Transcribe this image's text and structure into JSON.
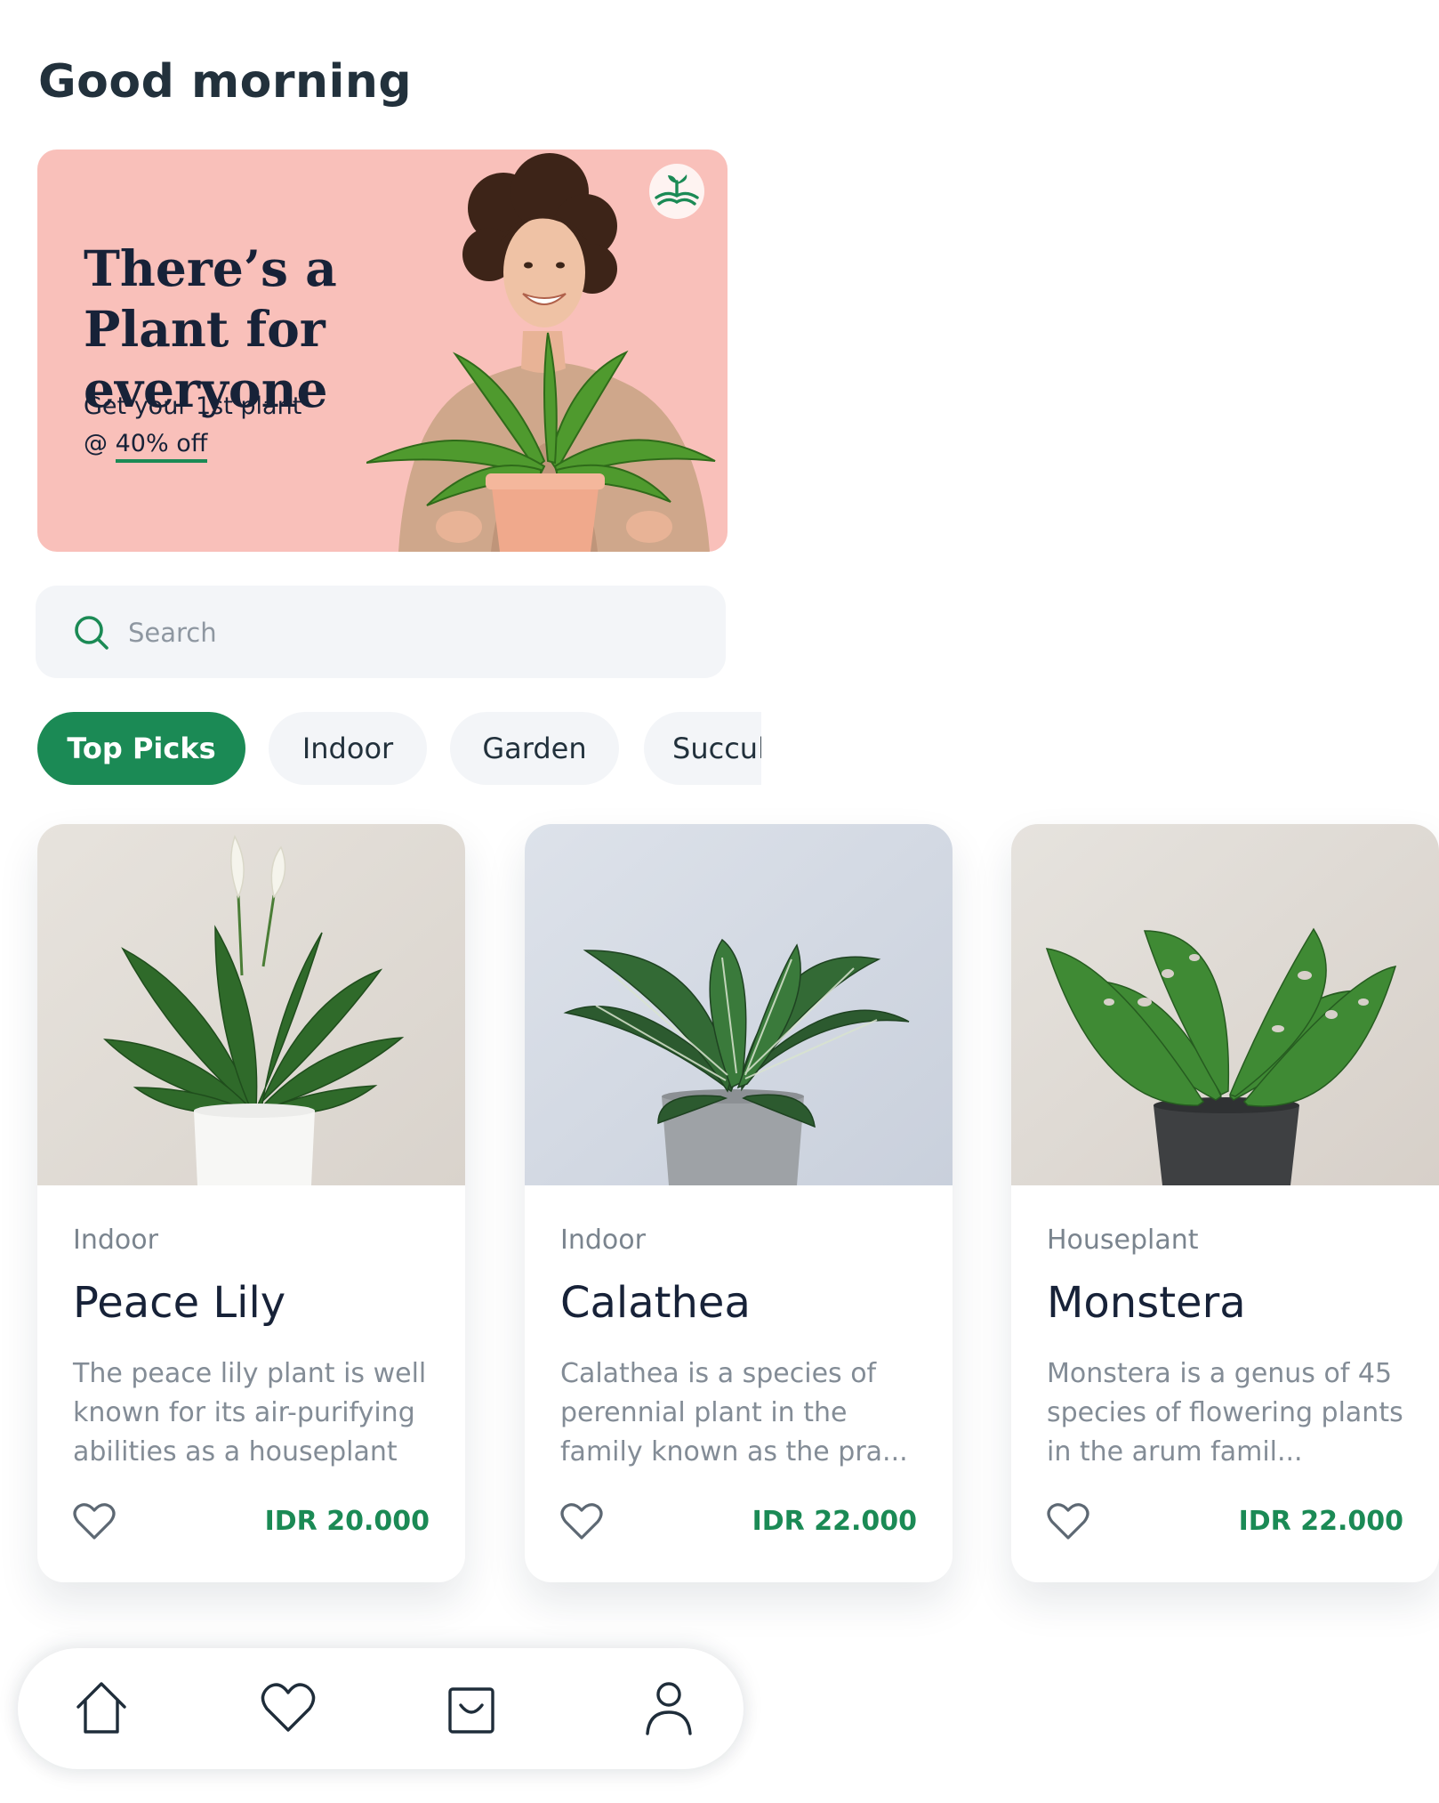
{
  "greeting": "Good morning",
  "banner": {
    "title": "There’s a Plant for everyone",
    "subtitle_prefix": "Get your 1st plant",
    "offer_prefix": "@ ",
    "offer": "40% off",
    "logo_icon": "sprout-logo-icon"
  },
  "search": {
    "placeholder": "Search",
    "value": "",
    "icon": "search-icon"
  },
  "categories": [
    {
      "label": "Top Picks",
      "active": true
    },
    {
      "label": "Indoor",
      "active": false
    },
    {
      "label": "Garden",
      "active": false
    },
    {
      "label": "Succulent",
      "active": false
    }
  ],
  "products": [
    {
      "category": "Indoor",
      "name": "Peace Lily",
      "description": "The peace lily plant is well known for its air-purifying abilities as a houseplant",
      "price": "IDR 20.000",
      "favorite_icon": "heart-outline-icon"
    },
    {
      "category": "Indoor",
      "name": "Calathea",
      "description": "Calathea is a species of perennial plant in the family known as the pra...",
      "price": "IDR 22.000",
      "favorite_icon": "heart-outline-icon"
    },
    {
      "category": "Houseplant",
      "name": "Monstera",
      "description": "Monstera is a genus of 45 species of flowering plants in the arum famil...",
      "price": "IDR 22.000",
      "favorite_icon": "heart-outline-icon"
    }
  ],
  "nav": [
    {
      "icon": "home-icon"
    },
    {
      "icon": "heart-icon"
    },
    {
      "icon": "shopping-bag-icon"
    },
    {
      "icon": "profile-icon"
    }
  ],
  "colors": {
    "accent": "#1b8a55",
    "banner_bg": "#f9c0ba",
    "surface_muted": "#f3f5f8",
    "text_dark": "#172238"
  }
}
